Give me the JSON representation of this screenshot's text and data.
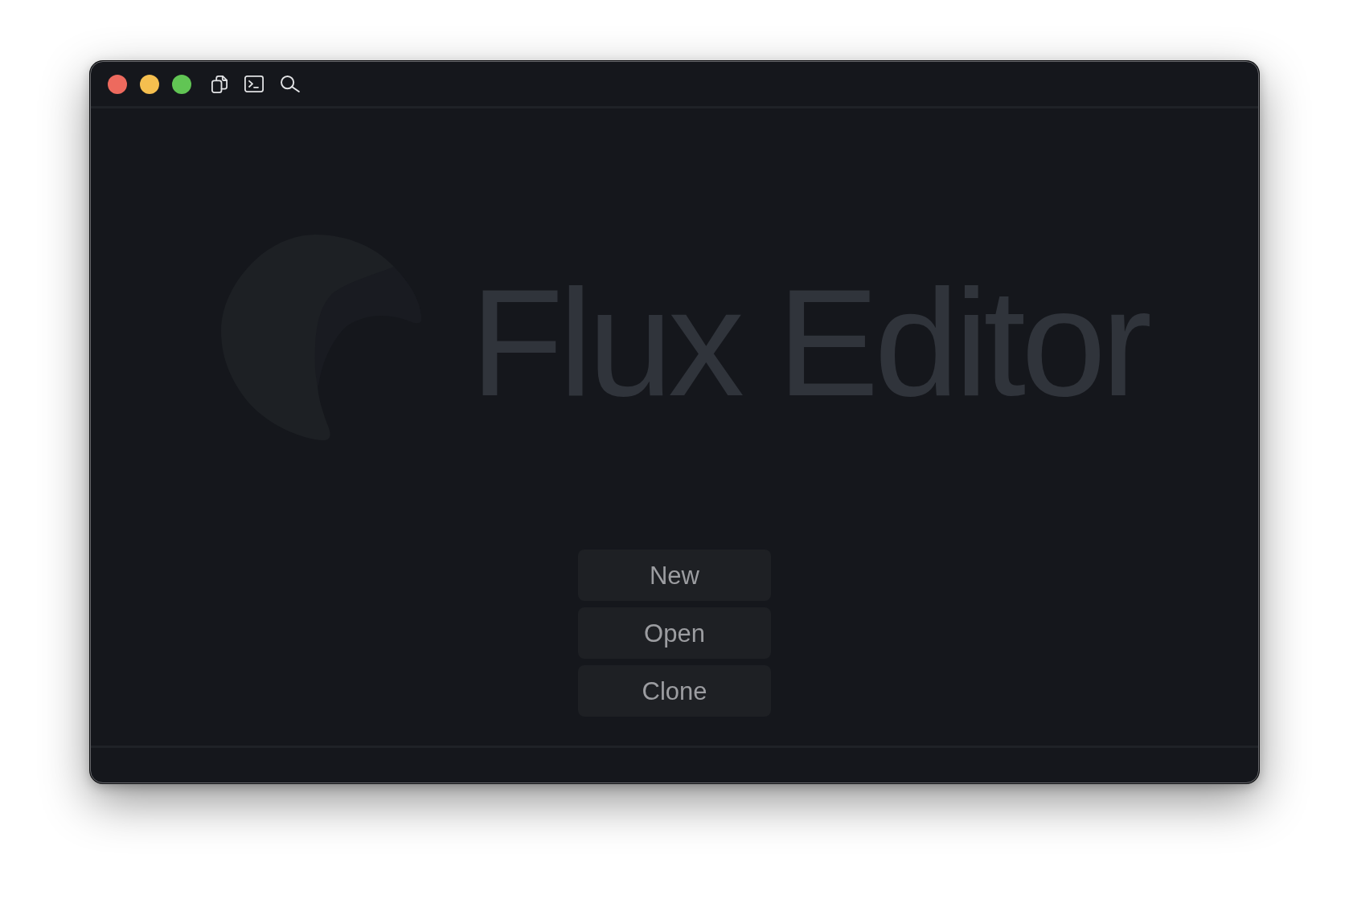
{
  "window": {
    "controls": [
      {
        "color": "#ed6a5e"
      },
      {
        "color": "#f5bf4f"
      },
      {
        "color": "#61c554"
      }
    ]
  },
  "logo": {
    "text": "Flux Editor"
  },
  "actions": [
    "New",
    "Open",
    "Clone"
  ]
}
